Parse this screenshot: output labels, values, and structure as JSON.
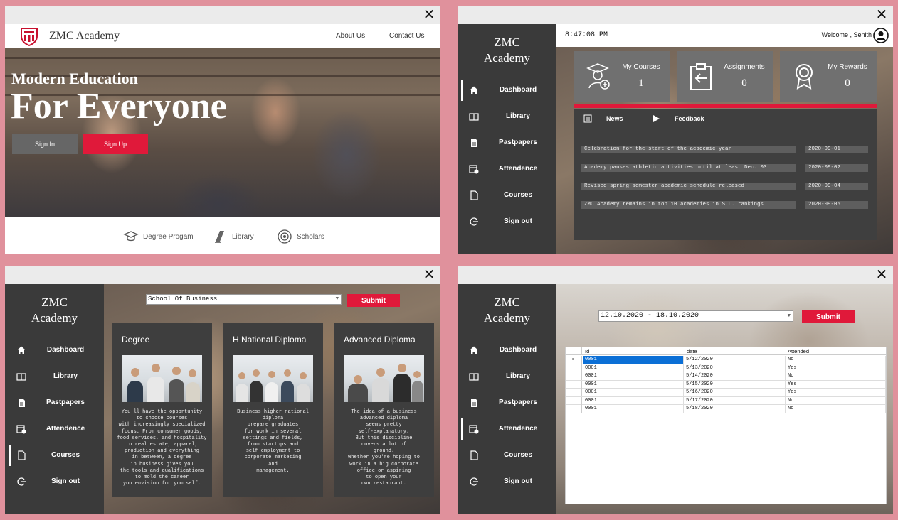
{
  "landing": {
    "brand": "ZMC Academy",
    "nav": {
      "about": "About Us",
      "contact": "Contact Us"
    },
    "hero_small": "Modern Education",
    "hero_big": "For Everyone",
    "signin": "Sign In",
    "signup": "Sign Up",
    "features": [
      "Degree Progam",
      "Library",
      "Scholars"
    ]
  },
  "sidebar": {
    "brand_line1": "ZMC",
    "brand_line2": "Academy",
    "items": [
      "Dashboard",
      "Library",
      "Pastpapers",
      "Attendence",
      "Courses",
      "Sign out"
    ]
  },
  "dashboard": {
    "time": "8:47:08 PM",
    "welcome": "Welcome , Senith",
    "cards": [
      {
        "title": "My Courses",
        "value": "1"
      },
      {
        "title": "Assignments",
        "value": "0"
      },
      {
        "title": "My Rewards",
        "value": "0"
      }
    ],
    "tabs": {
      "news": "News",
      "feedback": "Feedback"
    },
    "news": [
      {
        "text": "Celebration for the start of the academic year",
        "date": "2020-09-01"
      },
      {
        "text": "Academy pauses athletic activities until at least Dec. 03",
        "date": "2020-09-02"
      },
      {
        "text": "Revised spring semester academic schedule released",
        "date": "2020-09-04"
      },
      {
        "text": "ZMC Academy remains in top 10 academies in S.L. rankings",
        "date": "2020-09-05"
      }
    ]
  },
  "courses": {
    "school_select": "School Of Business",
    "submit": "Submit",
    "cards": [
      {
        "title": "Degree",
        "desc": "You'll have the opportunity\nto choose courses\nwith increasingly specialized\nfocus. From consumer goods,\nfood services, and hospitality\nto real estate, apparel,\nproduction and everything\nin between, a degree\nin business gives you\nthe tools and qualifications\nto mold the career\nyou envision for yourself."
      },
      {
        "title": "H National Diploma",
        "desc": "Business higher national\ndiploma\nprepare graduates\nfor work in several\nsettings and fields,\nfrom startups and\nself employment to\ncorporate marketing\nand\nmanagement."
      },
      {
        "title": "Advanced Diploma",
        "desc": "The idea of a business\nadvanced diploma\nseems pretty\nself-explanatory.\nBut this discipline\ncovers a lot of\nground.\nWhether you're hoping to\nwork in a big corporate\noffice or aspiring\nto open your\nown restaurant."
      }
    ]
  },
  "attendance": {
    "week_select": "12.10.2020 - 18.10.2020",
    "submit": "Submit",
    "columns": [
      "Id",
      "date",
      "Attended"
    ],
    "rows": [
      {
        "id": "0001",
        "date": "5/12/2020",
        "attended": "No"
      },
      {
        "id": "0001",
        "date": "5/13/2020",
        "attended": "Yes"
      },
      {
        "id": "0001",
        "date": "5/14/2020",
        "attended": "No"
      },
      {
        "id": "0001",
        "date": "5/15/2020",
        "attended": "Yes"
      },
      {
        "id": "0001",
        "date": "5/16/2020",
        "attended": "Yes"
      },
      {
        "id": "0001",
        "date": "5/17/2020",
        "attended": "No"
      },
      {
        "id": "0001",
        "date": "5/18/2020",
        "attended": "No"
      }
    ]
  },
  "colors": {
    "accent": "#e0193a",
    "sidebar": "#3a3a3a",
    "background": "#e0919c"
  },
  "icons": [
    "close-icon",
    "shield-logo-icon",
    "home-icon",
    "book-icon",
    "document-icon",
    "calendar-check-icon",
    "file-icon",
    "signout-icon",
    "user-avatar-icon",
    "graduate-icon",
    "clipboard-icon",
    "award-icon",
    "news-icon",
    "play-icon",
    "graduation-cap-icon",
    "books-icon",
    "scholar-icon"
  ]
}
